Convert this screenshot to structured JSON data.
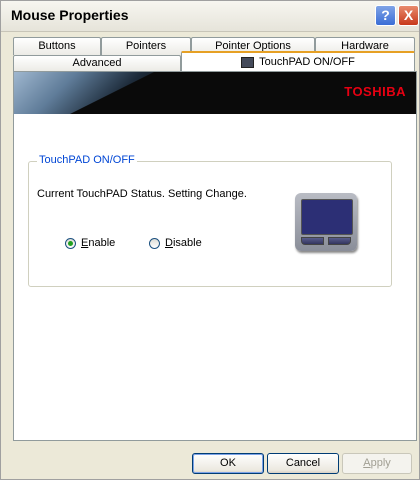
{
  "window": {
    "title": "Mouse Properties"
  },
  "titlebar": {
    "help_label": "?",
    "close_label": "X"
  },
  "tabs": {
    "row1": [
      "Buttons",
      "Pointers",
      "Pointer Options",
      "Hardware"
    ],
    "row2": [
      "Advanced",
      "TouchPAD ON/OFF"
    ],
    "active": "TouchPAD ON/OFF"
  },
  "banner": {
    "brand": "TOSHIBA"
  },
  "group": {
    "title": "TouchPAD ON/OFF",
    "status_text": "Current TouchPAD Status. Setting Change.",
    "options": [
      {
        "mnemonic": "E",
        "rest": "nable",
        "selected": true
      },
      {
        "mnemonic": "D",
        "rest": "isable",
        "selected": false
      }
    ]
  },
  "buttons": {
    "ok": "OK",
    "cancel": "Cancel",
    "apply_mnemonic": "A",
    "apply_rest": "pply"
  },
  "colors": {
    "accent": "#0046d5",
    "brand_red": "#e60012",
    "touchpad": "#2c2f75"
  }
}
